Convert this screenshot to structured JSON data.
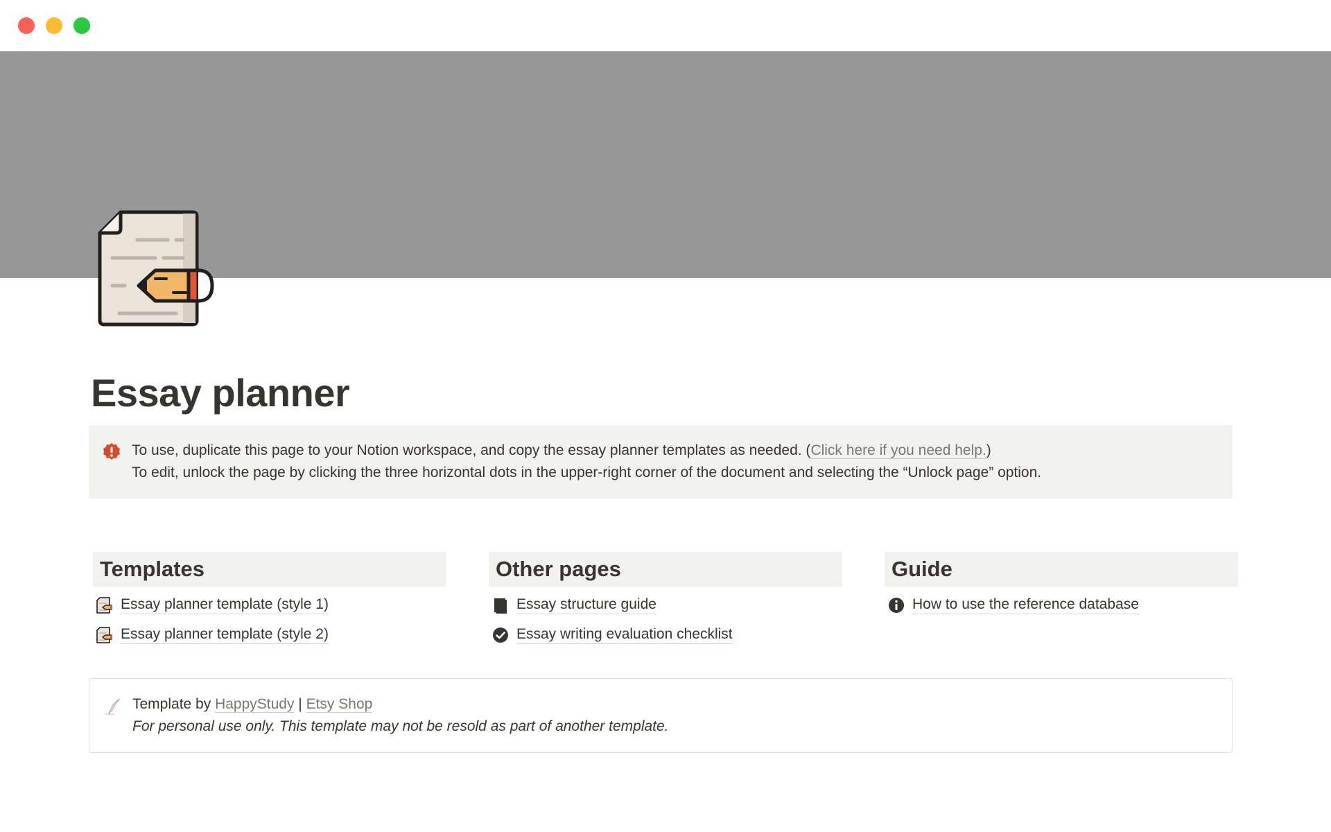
{
  "page": {
    "title": "Essay planner"
  },
  "callout": {
    "icon": "alert-circle-icon",
    "line1_text": "To use, duplicate this page to your Notion workspace, and copy the essay planner templates as needed. (",
    "line1_link": "Click here if you need help.",
    "line1_end": ")",
    "line2_text": "To edit, unlock the page by clicking the three horizontal dots in the upper-right corner of the document and selecting the “Unlock page” option."
  },
  "columns": [
    {
      "heading": "Templates",
      "items": [
        {
          "label": "Essay planner template (style 1)",
          "icon": "essay-document-icon"
        },
        {
          "label": "Essay planner template (style 2)",
          "icon": "essay-document-icon"
        }
      ]
    },
    {
      "heading": "Other pages",
      "items": [
        {
          "label": "Essay structure guide",
          "icon": "book-icon"
        },
        {
          "label": "Essay writing evaluation checklist",
          "icon": "check-circle-icon"
        }
      ]
    },
    {
      "heading": "Guide",
      "items": [
        {
          "label": "How to use the reference database",
          "icon": "info-circle-icon"
        }
      ]
    }
  ],
  "footer": {
    "icon": "quill-pen-icon",
    "prefix": "Template by ",
    "author_link": "HappyStudy",
    "separator": " | ",
    "shop_link": "Etsy Shop",
    "note": "For personal use only. This template may not be resold as part of another template."
  },
  "colors": {
    "cover": "#979797",
    "callout_bg": "#f1f1ef",
    "alert": "#d44c2f",
    "text": "#37352f",
    "muted_link": "#787774"
  }
}
